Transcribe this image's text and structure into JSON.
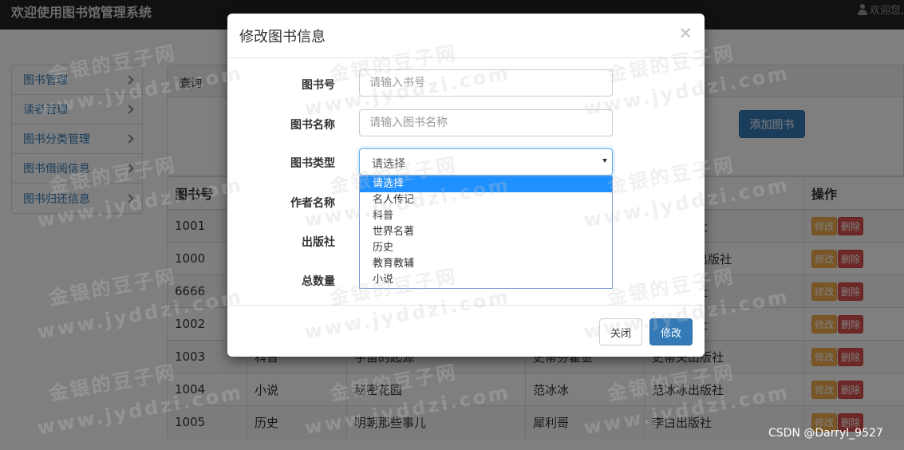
{
  "navbar": {
    "brand": "欢迎使用图书馆管理系统",
    "welcome": "欢迎您,"
  },
  "sidebar": {
    "items": [
      {
        "label": "图书管理"
      },
      {
        "label": "读者管理"
      },
      {
        "label": "图书分类管理"
      },
      {
        "label": "图书借阅信息"
      },
      {
        "label": "图书归还信息"
      }
    ]
  },
  "panel": {
    "title": "查询",
    "add_button": "添加图书"
  },
  "table": {
    "headers": [
      "图书号",
      "",
      "",
      "",
      "",
      "操作"
    ],
    "rows": [
      [
        "1001",
        "",
        "",
        "",
        "社"
      ],
      [
        "1000",
        "",
        "",
        "",
        "出版社"
      ],
      [
        "6666",
        "",
        "",
        "",
        "社"
      ],
      [
        "1002",
        "",
        "",
        "",
        "社"
      ],
      [
        "1003",
        "科普",
        "宇宙的起源",
        "史蒂芬霍金",
        "史蒂夫出版社"
      ],
      [
        "1004",
        "小说",
        "秘密花园",
        "范冰冰",
        "范冰冰出版社"
      ],
      [
        "1005",
        "历史",
        "明朝那些事儿",
        "犀利哥",
        "李白出版社"
      ]
    ],
    "edit_label": "修改",
    "delete_label": "删除"
  },
  "modal": {
    "title": "修改图书信息",
    "close_x": "×",
    "fields": {
      "book_id": {
        "label": "图书号",
        "placeholder": "请输入书号"
      },
      "book_name": {
        "label": "图书名称",
        "placeholder": "请输入图书名称"
      },
      "book_type": {
        "label": "图书类型",
        "selected": "请选择"
      },
      "author": {
        "label": "作者名称"
      },
      "publisher": {
        "label": "出版社"
      },
      "total": {
        "label": "总数量"
      }
    },
    "type_options": [
      "请选择",
      "名人传记",
      "科普",
      "世界名著",
      "历史",
      "教育教辅",
      "小说"
    ],
    "close_button": "关闭",
    "save_button": "修改"
  },
  "watermark": {
    "cn": "金银的豆子网",
    "url": "www.jyddzi.com"
  },
  "csdn": "CSDN @Darryl_9527"
}
